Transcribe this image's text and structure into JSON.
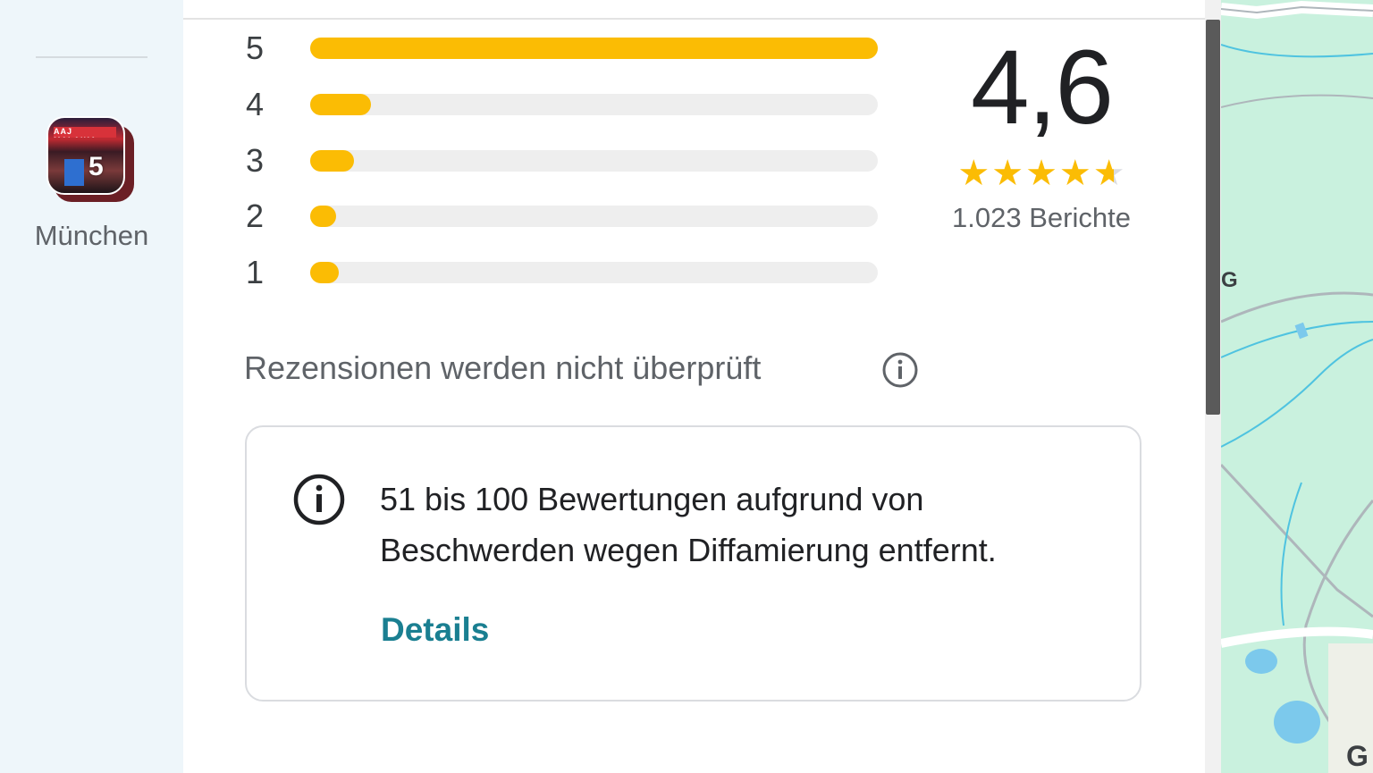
{
  "rail": {
    "place_label": "München",
    "photo_count": "5",
    "photo_sign_text": "AAJ MALAIKA"
  },
  "histogram": [
    {
      "stars": "5",
      "fraction": 1.0
    },
    {
      "stars": "4",
      "fraction": 0.107
    },
    {
      "stars": "3",
      "fraction": 0.077
    },
    {
      "stars": "2",
      "fraction": 0.045
    },
    {
      "stars": "1",
      "fraction": 0.05
    }
  ],
  "summary": {
    "score": "4,6",
    "star_rating": 4.6,
    "reports": "1.023 Berichte"
  },
  "verification": {
    "text": "Rezensionen werden nicht überprüft"
  },
  "notice": {
    "text": "51 bis 100 Bewertungen aufgrund von Beschwerden wegen Diffamierung entfernt.",
    "link": "Details"
  },
  "map": {
    "label_1": "G",
    "label_2": "G"
  },
  "colors": {
    "star": "#fbbc04",
    "link": "#1a7f91",
    "map_green": "#c9f1de"
  }
}
